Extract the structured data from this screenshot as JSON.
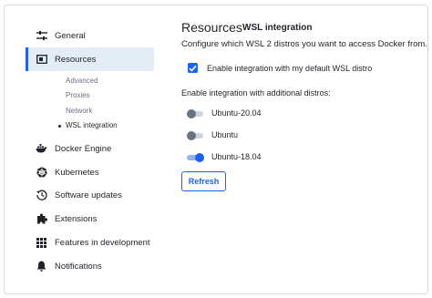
{
  "sidebar": {
    "items": [
      {
        "label": "General",
        "icon": "sliders-icon"
      },
      {
        "label": "Resources",
        "icon": "resources-icon",
        "active": true
      },
      {
        "label": "Docker Engine",
        "icon": "whale-icon"
      },
      {
        "label": "Kubernetes",
        "icon": "helm-wheel-icon"
      },
      {
        "label": "Software updates",
        "icon": "clock-history-icon"
      },
      {
        "label": "Extensions",
        "icon": "puzzle-icon"
      },
      {
        "label": "Features in development",
        "icon": "grid-icon"
      },
      {
        "label": "Notifications",
        "icon": "bell-icon"
      }
    ],
    "subitems": [
      {
        "label": "Advanced"
      },
      {
        "label": "Proxies"
      },
      {
        "label": "Network"
      },
      {
        "label": "WSL integration",
        "current": true
      }
    ]
  },
  "main": {
    "title": "Resources",
    "tab": "WSL integration",
    "description": "Configure which WSL 2 distros you want to access Docker from.",
    "default_distro": {
      "label": "Enable integration with my default WSL distro",
      "checked": true
    },
    "additional_label": "Enable integration with additional distros:",
    "distros": [
      {
        "name": "Ubuntu-20.04",
        "enabled": false
      },
      {
        "name": "Ubuntu",
        "enabled": false
      },
      {
        "name": "Ubuntu-18.04",
        "enabled": true
      }
    ],
    "refresh_label": "Refresh"
  },
  "colors": {
    "accent": "#1d63ed",
    "active_bg": "#e4ecf6",
    "muted_text": "#677283"
  }
}
